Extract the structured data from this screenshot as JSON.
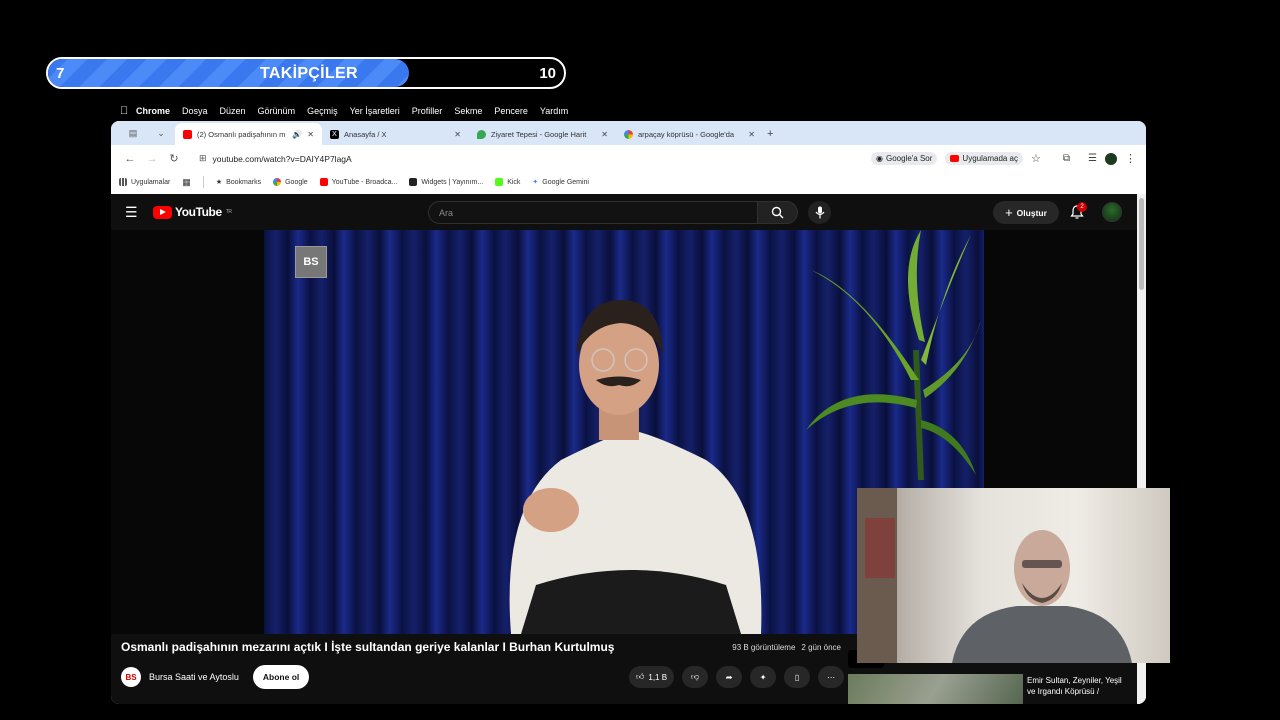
{
  "overlay": {
    "left_value": "7",
    "title": "TAKİPÇİLER",
    "right_value": "10",
    "progress": 0.7,
    "bar_color": "#3a78f0"
  },
  "menubar": {
    "items": [
      "Chrome",
      "Dosya",
      "Düzen",
      "Görünüm",
      "Geçmiş",
      "Yer İşaretleri",
      "Profiller",
      "Sekme",
      "Pencere",
      "Yardım"
    ]
  },
  "tabs": [
    {
      "title": "(2) Osmanlı padişahının m",
      "favicon": "youtube-icon",
      "active": true
    },
    {
      "title": "Anasayfa / X",
      "favicon": "x-icon",
      "active": false
    },
    {
      "title": "Ziyaret Tepesi - Google Harit",
      "favicon": "maps-icon",
      "active": false
    },
    {
      "title": "arpaçay köprüsü - Google'da",
      "favicon": "google-icon",
      "active": false
    }
  ],
  "toolbar": {
    "url": "youtube.com/watch?v=DAIY4P7lagA",
    "ask_google": "Google'a Sor",
    "open_in_app": "Uygulamada aç"
  },
  "bookmarks": [
    "Uygulamalar",
    "Bookmarks",
    "Google",
    "YouTube - Broadca...",
    "Widgets | Yayınım...",
    "Kick",
    "Google Gemini"
  ],
  "youtube": {
    "country": "TR",
    "logo_text": "YouTube",
    "search_placeholder": "Ara",
    "create_label": "Oluştur",
    "notification_count": "2",
    "video_title": "Osmanlı padişahının mezarını açtık I İşte sultandan geriye kalanlar I Burhan Kurtulmuş",
    "views": "93 B görüntüleme",
    "age": "2 gün önce",
    "channel": "Bursa Saati ve Aytoslu",
    "subscribe": "Abone ol",
    "likes": "1,1 B",
    "brand_logo": "BS",
    "side_title": "Emir Sultan, Zeyniler, Yeşil ve Irgandı Köprüsü /"
  },
  "colors": {
    "yt_red": "#ff0000",
    "yt_bg": "#0f0f0f",
    "chrome_tab_strip": "#d8e6f8"
  }
}
